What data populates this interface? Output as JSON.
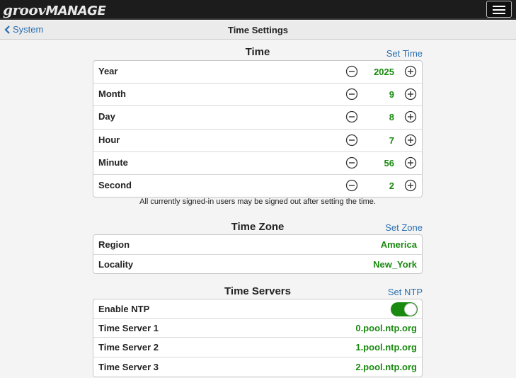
{
  "header": {
    "logo_part1": "groov",
    "logo_part2": "MANAGE",
    "menu_icon": "hamburger-menu-icon"
  },
  "nav": {
    "back_label": "System",
    "page_title": "Time Settings"
  },
  "time": {
    "title": "Time",
    "action": "Set Time",
    "rows": [
      {
        "label": "Year",
        "value": "2025"
      },
      {
        "label": "Month",
        "value": "9"
      },
      {
        "label": "Day",
        "value": "8"
      },
      {
        "label": "Hour",
        "value": "7"
      },
      {
        "label": "Minute",
        "value": "56"
      },
      {
        "label": "Second",
        "value": "2"
      }
    ],
    "note": "All currently signed-in users may be signed out after setting the time."
  },
  "timezone": {
    "title": "Time Zone",
    "action": "Set Zone",
    "region_label": "Region",
    "region_value": "America",
    "locality_label": "Locality",
    "locality_value": "New_York"
  },
  "timeservers": {
    "title": "Time Servers",
    "action": "Set NTP",
    "enable_label": "Enable NTP",
    "enable_state": "on",
    "servers": [
      {
        "label": "Time Server 1",
        "value": "0.pool.ntp.org"
      },
      {
        "label": "Time Server 2",
        "value": "1.pool.ntp.org"
      },
      {
        "label": "Time Server 3",
        "value": "2.pool.ntp.org"
      }
    ]
  },
  "colors": {
    "accent_link": "#2a6fb0",
    "value_green": "#1a8a10",
    "topbar": "#1c1c1c"
  }
}
